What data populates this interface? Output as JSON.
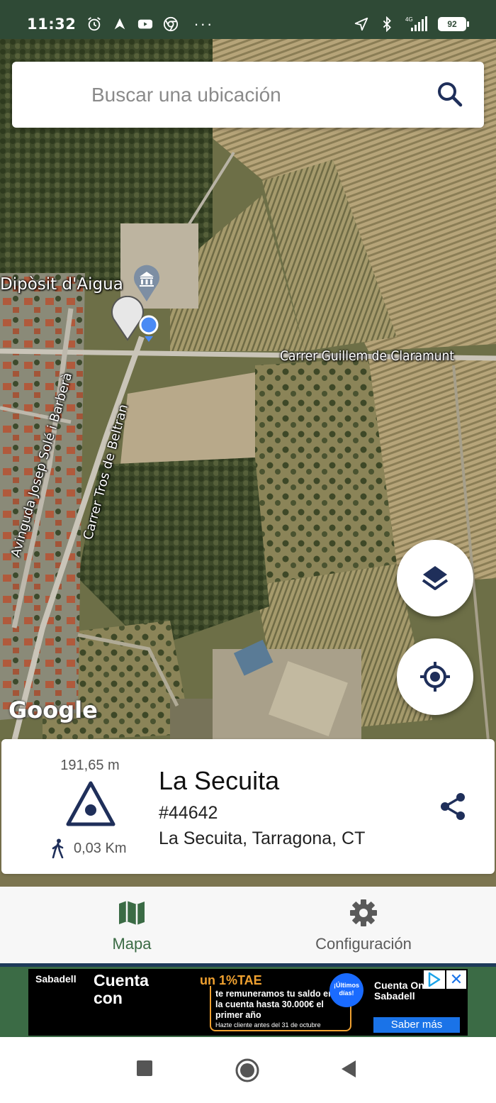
{
  "status_bar": {
    "time": "11:32",
    "network": "4G",
    "battery_level": "92",
    "more_indicator": "···",
    "icons": [
      "alarm-icon",
      "navigation-app-icon",
      "youtube-icon",
      "chrome-icon",
      "location-arrow-icon",
      "bluetooth-icon",
      "signal-icon",
      "battery-icon"
    ]
  },
  "search": {
    "placeholder": "Buscar una ubicación",
    "icon": "search-icon"
  },
  "map": {
    "poi_label": "Dipòsit d'Aigua",
    "street_labels": [
      "Carrer Guillem de Claramunt",
      "Avinguda Josep Solé i Barberà",
      "Carrer Tros de Beltran"
    ],
    "attribution": "Google",
    "layer_type": "satellite"
  },
  "fabs": {
    "layers_icon": "layers-icon",
    "my_location_icon": "my-location-icon"
  },
  "place_card": {
    "elevation": "191,65 m",
    "distance": "0,03 Km",
    "name": "La Secuita",
    "id": "#44642",
    "address": "La Secuita, Tarragona, CT"
  },
  "bottom_nav": {
    "items": [
      {
        "label": "Mapa",
        "icon": "map-icon",
        "active": true
      },
      {
        "label": "Configuración",
        "icon": "gear-icon",
        "active": false
      }
    ]
  },
  "ad": {
    "brand": "Sabadell",
    "headline": "Cuenta con",
    "rate": "un 1%TAE",
    "offer": "te remuneramos tu saldo en la cuenta hasta 30.000€ el primer año",
    "fineprint": "Hazte cliente antes del 31 de octubre",
    "badge": "¡Últimos días!",
    "cta_title": "Cuenta Online Sabadell",
    "cta_button": "Saber más",
    "close": "✕"
  },
  "colors": {
    "status_bar": "#2f4a36",
    "accent": "#3b6b45",
    "icon_dark": "#1f2f5a"
  }
}
